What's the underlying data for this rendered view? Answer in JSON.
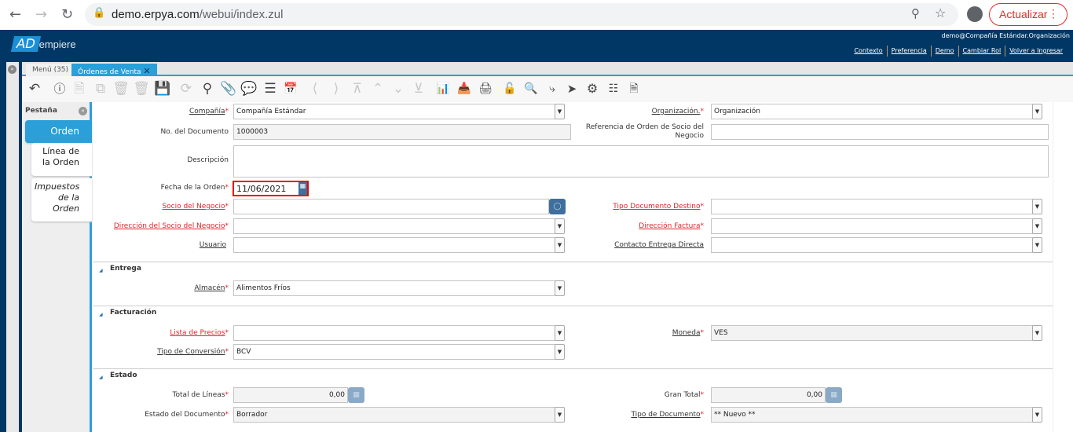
{
  "browser": {
    "url_domain": "demo.erpya.com",
    "url_path": "/webui/index.zul",
    "update_label": "Actualizar"
  },
  "header": {
    "logo_ad": "AD",
    "logo_rest": "empiere",
    "user_context": "demo@Compañía Estándar.Organización",
    "links": [
      "Contexto",
      "Preferencia",
      "Demo",
      "Cambiar Rol",
      "Volver a Ingresar"
    ]
  },
  "tabs": {
    "menu": "Menú (35)",
    "active": "Órdenes de Venta"
  },
  "toolbar_icons": [
    "undo",
    "help",
    "new",
    "copy",
    "delete",
    "delete-selected",
    "save",
    "refresh",
    "find",
    "attachment",
    "chat",
    "grid-toggle",
    "history",
    "previous",
    "next",
    "first",
    "parent",
    "detail",
    "last",
    "report",
    "archive",
    "print",
    "lock",
    "zoom-across",
    "workflow",
    "request",
    "process",
    "product-info",
    "report-view"
  ],
  "side": {
    "title": "Pestaña",
    "tabs": [
      "Orden",
      "Línea de la Orden",
      "Impuestos de la Orden"
    ]
  },
  "form": {
    "company_label": "Compañía",
    "company": "Compañía Estándar",
    "org_label": "Organización.",
    "org": "Organización",
    "docno_label": "No. del Documento",
    "docno": "1000003",
    "bporef_label": "Referencia de Orden de Socio del Negocio",
    "bporef": "",
    "desc_label": "Descripción",
    "desc": "",
    "date_label": "Fecha de la Orden",
    "date": "11/06/2021",
    "bp_label": "Socio del Negocio",
    "bp": "",
    "doctypetarget_label": "Tipo Documento Destino",
    "doctypetarget": "",
    "bploc_label": "Dirección del Socio del Negocio",
    "bploc": "",
    "billloc_label": "Dirección Factura",
    "billloc": "",
    "user_label": "Usuario",
    "user": "",
    "dropship_label": "Contacto Entrega Directa",
    "dropship": ""
  },
  "sections": {
    "delivery": {
      "title": "Entrega",
      "warehouse_label": "Almacén",
      "warehouse": "Alimentos Fríos"
    },
    "invoicing": {
      "title": "Facturación",
      "pricelist_label": "Lista de Precios",
      "pricelist": "",
      "currency_label": "Moneda",
      "currency": "VES",
      "convtype_label": "Tipo de Conversión",
      "convtype": "BCV"
    },
    "status": {
      "title": "Estado",
      "totallines_label": "Total de Líneas",
      "totallines": "0,00",
      "grandtotal_label": "Gran Total",
      "grandtotal": "0,00",
      "docstatus_label": "Estado del Documento",
      "docstatus": "Borrador",
      "doctype_label": "Tipo de Documento",
      "doctype": "** Nuevo **"
    }
  },
  "colors": {
    "header": "#003764",
    "accent": "#2a9fd8",
    "required": "#e0262e"
  }
}
